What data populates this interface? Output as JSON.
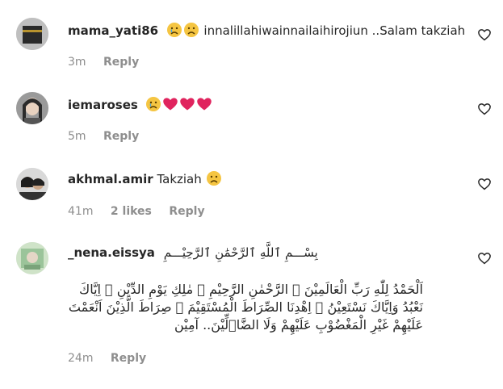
{
  "comments": [
    {
      "username": "mama_yati86",
      "text": "innalillahiwainnailaihirojiun ..Salam takziah",
      "emojis": [
        "sad-face",
        "sad-face"
      ],
      "time": "3m",
      "reply_label": "Reply"
    },
    {
      "username": "iemaroses",
      "text": "",
      "emojis": [
        "sad-face",
        "red-heart",
        "red-heart",
        "red-heart"
      ],
      "time": "5m",
      "reply_label": "Reply"
    },
    {
      "username": "akhmal.amir",
      "text": "Takziah",
      "emojis": [
        "sad-face"
      ],
      "time": "41m",
      "likes": "2 likes",
      "reply_label": "Reply"
    },
    {
      "username": "_nena.eissya",
      "title_arabic": "بِسْـــمِ ٱللَّهِ ٱلرَّحْمَٰنِ ٱلرَّحِيْـــمِ",
      "body_arabic": "اَلْحَمْدُ لِلّٰهِ رَبِّ الْعَالَمِيْنَ ۞ الرَّحْمٰنِ الرَّحِيْمِ ۞ مٰلِكِ يَوْمِ الدِّيْنِ ۞ اِيَّاكَ نَعْبُدُ وَاِيَّاكَ نَسْتَعِيْنُ ۞ اِهْدِنَا الصِّرَاطَ الْمُسْتَقِيْمَ ۞ صِرَاطَ الَّذِيْنَ اَنْعَمْتَ عَلَيْهِمْ غَيْرِ الْمَغْضُوْبِ عَلَيْهِمْ وَلَا الضَّاۤلِّيْنَ.. آمِيْن",
      "time": "24m",
      "reply_label": "Reply"
    }
  ],
  "colors": {
    "text": "#262626",
    "meta": "#8e8e8e",
    "heart": "#e0245e",
    "emoji_face": "#f5c542"
  }
}
